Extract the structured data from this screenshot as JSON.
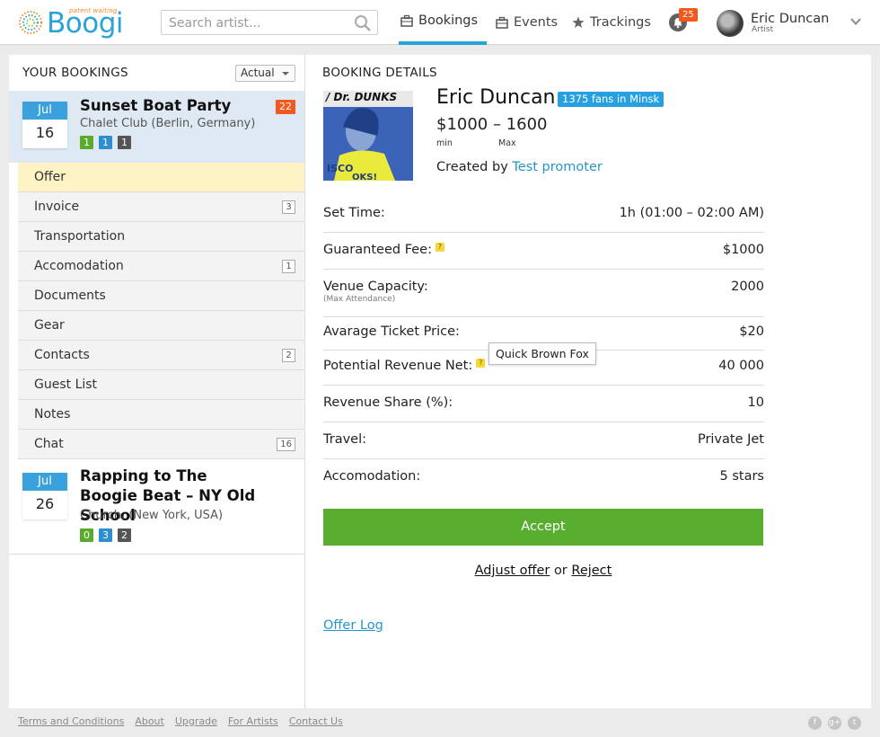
{
  "brand": {
    "name": "Boogi",
    "tagline": "patent waiting"
  },
  "search": {
    "placeholder": "Search artist..."
  },
  "nav": {
    "items": [
      {
        "label": "Bookings",
        "icon": "briefcase-icon",
        "active": true
      },
      {
        "label": "Events",
        "icon": "briefcase-icon",
        "active": false
      },
      {
        "label": "Trackings",
        "icon": "star-icon",
        "active": false
      }
    ],
    "notifications": "25"
  },
  "user": {
    "name": "Eric Duncan",
    "role": "Artist"
  },
  "bookings_panel": {
    "title": "YOUR BOOKINGS",
    "filter": "Actual",
    "bookings": [
      {
        "month": "Jul",
        "day": "16",
        "title": "Sunset Boat Party",
        "venue": "Chalet Club (Berlin, Germany)",
        "badge": "22",
        "chips": [
          "1",
          "1",
          "1"
        ]
      },
      {
        "month": "Jul",
        "day": "26",
        "title": "Rapping to The Boogie Beat – NY Old School",
        "venue": "Church, (New York, USA)",
        "chips": [
          "0",
          "3",
          "2"
        ]
      }
    ],
    "menu": [
      {
        "label": "Offer",
        "count": ""
      },
      {
        "label": "Invoice",
        "count": "3"
      },
      {
        "label": "Transportation",
        "count": ""
      },
      {
        "label": "Accomodation",
        "count": "1"
      },
      {
        "label": "Documents",
        "count": ""
      },
      {
        "label": "Gear",
        "count": ""
      },
      {
        "label": "Contacts",
        "count": "2"
      },
      {
        "label": "Guest List",
        "count": ""
      },
      {
        "label": "Notes",
        "count": ""
      },
      {
        "label": "Chat",
        "count": "16"
      }
    ]
  },
  "details": {
    "title": "BOOKING DETAILS",
    "photo_text": "/ Dr. DUNKS",
    "artist": "Eric Duncan",
    "fans": "1375 fans in Minsk",
    "fee_range": "$1000 – 1600",
    "fee_min_label": "min",
    "fee_max_label": "Max",
    "created_prefix": "Created by",
    "created_by": "Test promoter",
    "rows": [
      {
        "label": "Set Time:",
        "value": "1h (01:00 – 02:00 AM)"
      },
      {
        "label": "Guaranteed Fee:",
        "value": "$1000",
        "help": "?"
      },
      {
        "label": "Venue Capacity:",
        "value": "2000",
        "sub": "(Max Attendance)"
      },
      {
        "label": "Avarage Ticket Price:",
        "value": "$20"
      },
      {
        "label": "Potential Revenue Net:",
        "value": "40 000",
        "help": "?",
        "tooltip": "Quick Brown Fox"
      },
      {
        "label": "Revenue Share (%):",
        "value": "10"
      },
      {
        "label": "Travel:",
        "value": "Private Jet"
      },
      {
        "label": "Accomodation:",
        "value": "5 stars"
      }
    ],
    "accept": "Accept",
    "adjust": "Adjust offer",
    "or": "or",
    "reject": "Reject",
    "offer_log": "Offer Log"
  },
  "footer": {
    "links": [
      "Terms and Conditions",
      "About",
      "Upgrade",
      "For Artists",
      "Contact Us"
    ],
    "social": [
      {
        "icon": "facebook-icon",
        "glyph": "f"
      },
      {
        "icon": "google-plus-icon",
        "glyph": "g+"
      },
      {
        "icon": "twitter-icon",
        "glyph": "t"
      }
    ]
  },
  "colors": {
    "accent": "#2aa3d8",
    "accept": "#59ad2f",
    "badge": "#f2591e",
    "active_row": "#fdf3c4",
    "selected_booking": "#dfe9f4"
  }
}
